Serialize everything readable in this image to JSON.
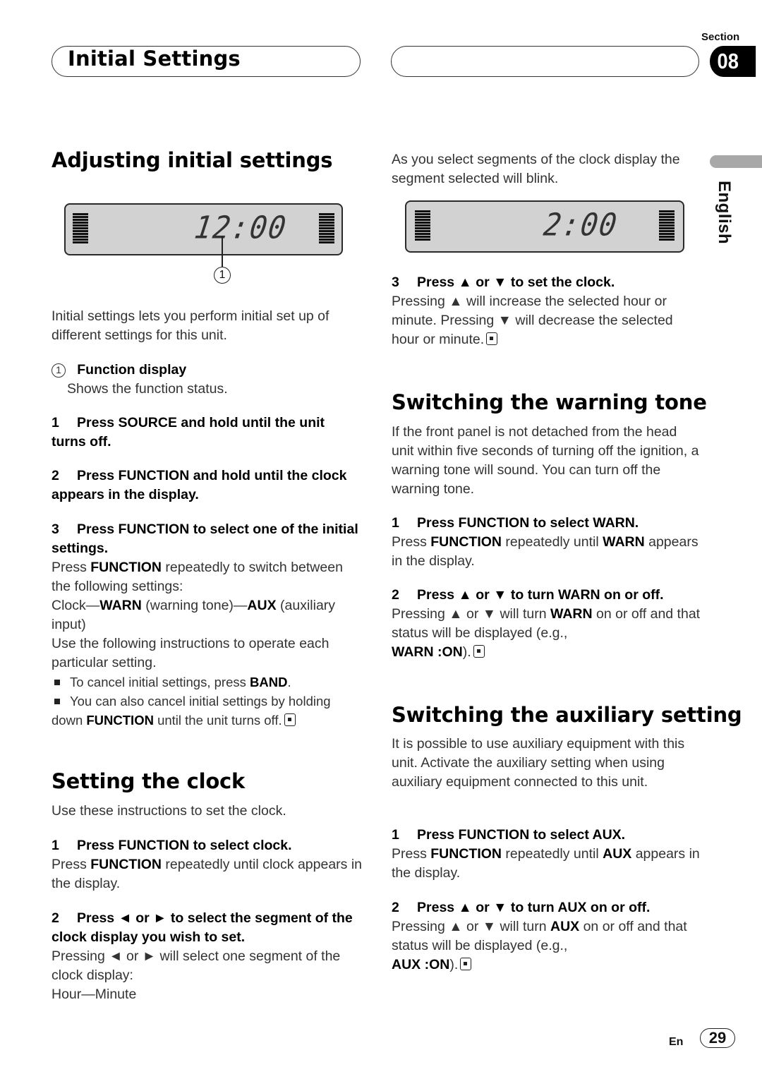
{
  "header": {
    "title": "Initial Settings",
    "section_label": "Section",
    "section_number": "08"
  },
  "side_tab": {
    "language": "English"
  },
  "left": {
    "adjusting": {
      "heading": "Adjusting initial settings",
      "display_digits": "12:00",
      "callout_number": "1",
      "intro": "Initial settings lets you perform initial set up of different settings for this unit.",
      "callout_title": "Function display",
      "callout_desc": "Shows the function status.",
      "step1": {
        "num": "1",
        "text": "Press SOURCE and hold until the unit turns off."
      },
      "step2": {
        "num": "2",
        "text": "Press FUNCTION and hold until the clock appears in the display."
      },
      "step3": {
        "num": "3",
        "text": "Press FUNCTION to select one of the initial settings."
      },
      "step3_body": {
        "p1_pre": "Press ",
        "p1_bold": "FUNCTION",
        "p1_post": " repeatedly to switch between the following settings:",
        "p2_a": "Clock—",
        "p2_b": "WARN",
        "p2_c": " (warning tone)—",
        "p2_d": "AUX",
        "p2_e": " (auxiliary input)",
        "p3": "Use the following instructions to operate each particular setting."
      },
      "notes": [
        {
          "pre": "To cancel initial settings, press ",
          "bold": "BAND",
          "post": "."
        },
        {
          "pre": "You can also cancel initial settings by holding down ",
          "bold": "FUNCTION",
          "post": " until the unit turns off."
        }
      ]
    },
    "clock": {
      "heading": "Setting the clock",
      "intro": "Use these instructions to set the clock.",
      "step1": {
        "num": "1",
        "text": "Press FUNCTION to select clock."
      },
      "step1_body": {
        "pre": "Press ",
        "bold": "FUNCTION",
        "post": " repeatedly until clock appears in the display."
      },
      "step2": {
        "num": "2",
        "text": "Press ◄ or ► to select the segment of the clock display you wish to set."
      },
      "step2_body": "Pressing ◄ or ► will select one segment of the clock display:",
      "step2_seq": "Hour—Minute"
    }
  },
  "right": {
    "clock_cont": {
      "intro": "As you select segments of the clock display the segment selected will blink.",
      "display_digits": "2:00",
      "step3": {
        "num": "3",
        "text": "Press ▲ or ▼ to set the clock."
      },
      "step3_body": "Pressing ▲ will increase the selected hour or minute. Pressing ▼ will decrease the selected hour or minute."
    },
    "warning": {
      "heading": "Switching the warning tone",
      "intro": "If the front panel is not detached from the head unit within five seconds of turning off the ignition, a warning tone will sound. You can turn off the warning tone.",
      "step1": {
        "num": "1",
        "text": "Press FUNCTION to select WARN."
      },
      "step1_body": {
        "a": "Press ",
        "b": "FUNCTION",
        "c": " repeatedly until ",
        "d": "WARN",
        "e": " appears in the display."
      },
      "step2": {
        "num": "2",
        "text": "Press ▲ or ▼ to turn WARN on or off."
      },
      "step2_body": {
        "a": "Pressing ▲ or ▼ will turn ",
        "b": "WARN",
        "c": " on or off and that status will be displayed (e.g.,",
        "d": "WARN :ON",
        "e": ")."
      }
    },
    "aux": {
      "heading": "Switching the auxiliary setting",
      "intro": "It is possible to use auxiliary equipment with this unit. Activate the auxiliary setting when using auxiliary equipment connected to this unit.",
      "step1": {
        "num": "1",
        "text": "Press FUNCTION to select AUX."
      },
      "step1_body": {
        "a": "Press ",
        "b": "FUNCTION",
        "c": " repeatedly until ",
        "d": "AUX",
        "e": " appears in the display."
      },
      "step2": {
        "num": "2",
        "text": "Press ▲ or ▼ to turn AUX on or off."
      },
      "step2_body": {
        "a": "Pressing ▲ or ▼ will turn ",
        "b": "AUX",
        "c": " on or off and that status will be displayed (e.g.,",
        "d": "AUX :ON",
        "e": ")."
      }
    }
  },
  "footer": {
    "lang_code": "En",
    "page_number": "29"
  }
}
